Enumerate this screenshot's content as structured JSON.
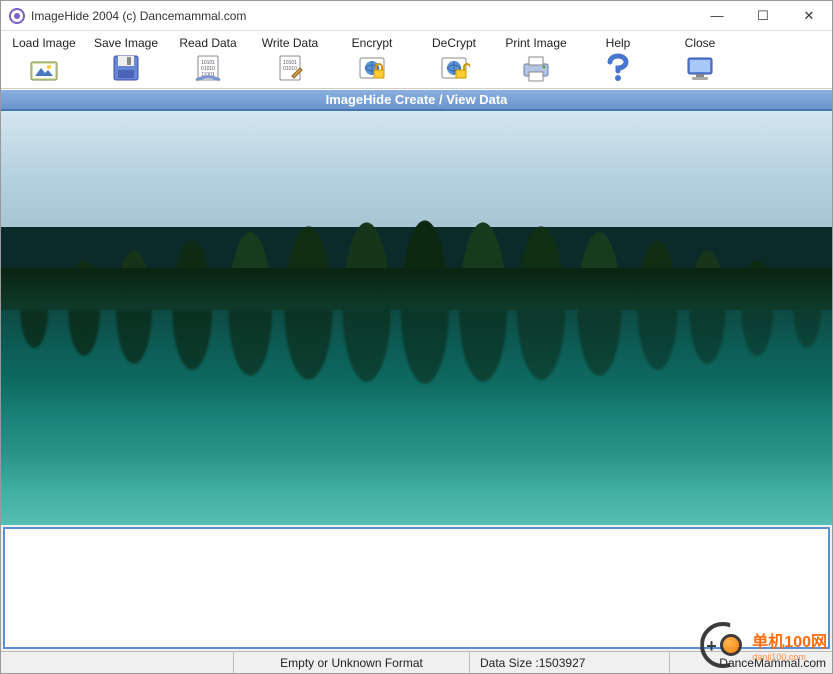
{
  "title": "ImageHide 2004 (c) Dancemammal.com",
  "window_controls": {
    "minimize": "—",
    "maximize": "☐",
    "close": "✕"
  },
  "toolbar": [
    {
      "label": "Load Image",
      "icon": "folder-image-icon"
    },
    {
      "label": "Save Image",
      "icon": "floppy-disk-icon"
    },
    {
      "label": "Read Data",
      "icon": "document-read-icon"
    },
    {
      "label": "Write Data",
      "icon": "document-write-icon"
    },
    {
      "label": "Encrypt",
      "icon": "lock-globe-icon"
    },
    {
      "label": "DeCrypt",
      "icon": "unlock-globe-icon"
    },
    {
      "label": "Print Image",
      "icon": "printer-icon"
    },
    {
      "label": "Help",
      "icon": "question-icon"
    },
    {
      "label": "Close",
      "icon": "monitor-icon"
    }
  ],
  "banner": "ImageHide Create / View Data",
  "textarea_value": "",
  "status": {
    "format": "Empty or Unknown Format",
    "size_label": "Data Size : ",
    "size_value": "1503927",
    "site": "DanceMammal.com"
  },
  "watermark": {
    "brand": "单机100网",
    "sub": "danji100.com"
  }
}
